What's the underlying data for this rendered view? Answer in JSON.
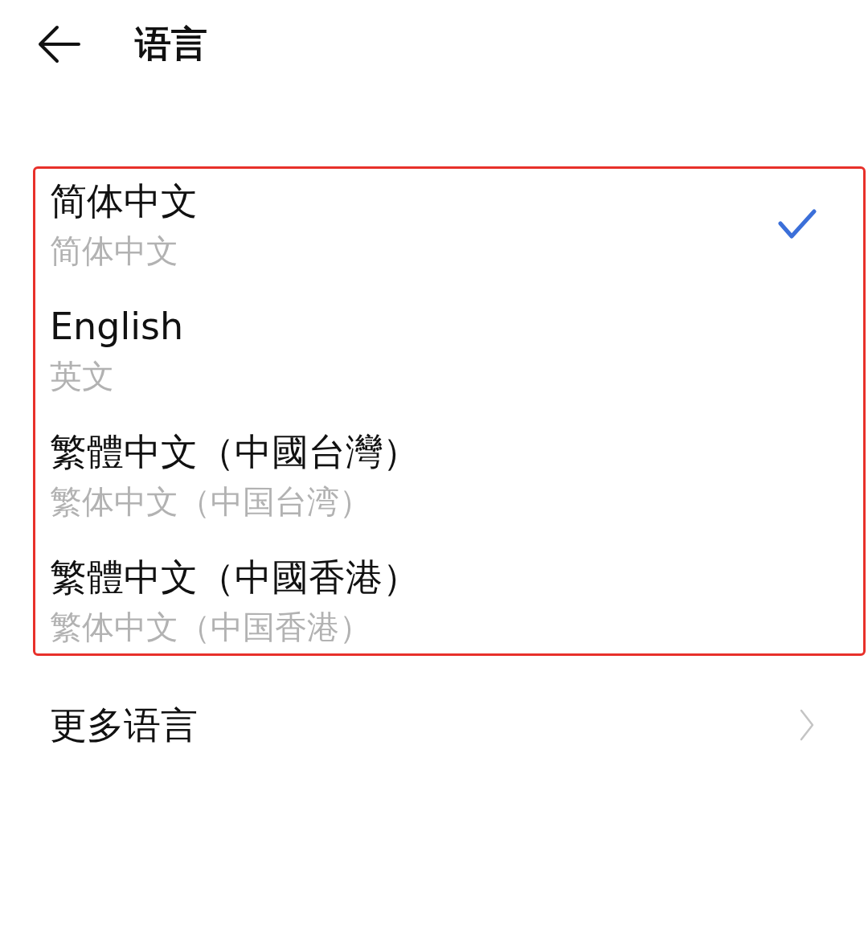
{
  "header": {
    "title": "语言"
  },
  "language_list": {
    "highlighted": true,
    "items": [
      {
        "name": "简体中文",
        "subtitle": "简体中文",
        "selected": true
      },
      {
        "name": "English",
        "subtitle": "英文",
        "selected": false
      },
      {
        "name": "繁體中文（中國台灣）",
        "subtitle": "繁体中文（中国台湾）",
        "selected": false
      },
      {
        "name": "繁體中文（中國香港）",
        "subtitle": "繁体中文（中国香港）",
        "selected": false
      }
    ]
  },
  "more_languages": {
    "label": "更多语言"
  }
}
